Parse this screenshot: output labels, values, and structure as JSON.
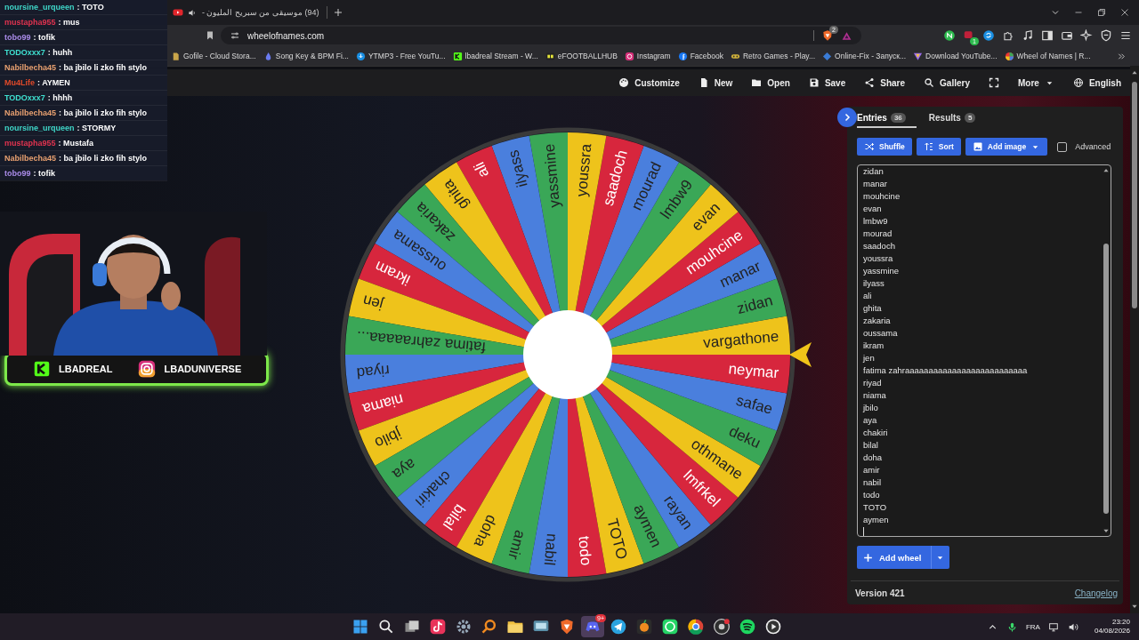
{
  "browser": {
    "tab": {
      "title": "(94) موسيقى من سبريح المليون -"
    },
    "address": "wheelofnames.com",
    "shield_badge": "2",
    "extension_badge": "1",
    "bookmarks": [
      "Gofile - Cloud Stora...",
      "Song Key & BPM Fi...",
      "YTMP3 - Free YouTu...",
      "lbadreal Stream - W...",
      "eFOOTBALLHUB",
      "Instagram",
      "Facebook",
      "Retro Games - Play...",
      "Online-Fix - Запуск...",
      "Download YouTube...",
      "Wheel of Names | R..."
    ]
  },
  "app": {
    "menu": [
      "Customize",
      "New",
      "Open",
      "Save",
      "Share",
      "Gallery",
      "More",
      "English"
    ]
  },
  "wheel": {
    "segments": [
      {
        "label": "vargathone"
      },
      {
        "label": "zidan"
      },
      {
        "label": "manar"
      },
      {
        "label": "mouhcine"
      },
      {
        "label": "evan"
      },
      {
        "label": "lmbw9"
      },
      {
        "label": "mourad"
      },
      {
        "label": "saadoch"
      },
      {
        "label": "youssra"
      },
      {
        "label": "yassmine"
      },
      {
        "label": "ilyass"
      },
      {
        "label": "ali"
      },
      {
        "label": "ghita"
      },
      {
        "label": "zakaria"
      },
      {
        "label": "oussama"
      },
      {
        "label": "ikram"
      },
      {
        "label": "jen"
      },
      {
        "label": "fatima zahraaaaa..."
      },
      {
        "label": "riyad"
      },
      {
        "label": "niama"
      },
      {
        "label": "jbilo"
      },
      {
        "label": "aya"
      },
      {
        "label": "chakiri"
      },
      {
        "label": "bilal"
      },
      {
        "label": "doha"
      },
      {
        "label": "amir"
      },
      {
        "label": "nabil"
      },
      {
        "label": "todo"
      },
      {
        "label": "TOTO"
      },
      {
        "label": "aymen"
      },
      {
        "label": "rayan"
      },
      {
        "label": "lmfrkel"
      },
      {
        "label": "othmane"
      },
      {
        "label": "deku"
      },
      {
        "label": "safae"
      },
      {
        "label": "neymar"
      }
    ]
  },
  "panel": {
    "tabs": [
      {
        "label": "Entries",
        "count": "36",
        "selected": true
      },
      {
        "label": "Results",
        "count": "5",
        "selected": false
      }
    ],
    "actions": [
      "Shuffle",
      "Sort",
      "Add image"
    ],
    "advanced": {
      "label": "Advanced",
      "checked": false
    },
    "entries": [
      "zidan",
      "manar",
      "mouhcine",
      "evan",
      "lmbw9",
      "mourad",
      "saadoch",
      "youssra",
      "yassmine",
      "ilyass",
      "ali",
      "ghita",
      "zakaria",
      "oussama",
      "ikram",
      "jen",
      "fatima zahraaaaaaaaaaaaaaaaaaaaaaaaaa",
      "riyad",
      "niama",
      "jbilo",
      "aya",
      "chakiri",
      "bilal",
      "doha",
      "amir",
      "nabil",
      "todo",
      "TOTO",
      "aymen"
    ],
    "add_wheel": "Add wheel",
    "version": "Version 421",
    "changelog": "Changelog"
  },
  "chat": [
    {
      "user": "noursine_urqueen",
      "color": "#3fd6c8",
      "text": ": TOTO"
    },
    {
      "user": "mustapha955",
      "color": "#e0334f",
      "text": ": mus"
    },
    {
      "user": "tobo99",
      "color": "#a98be8",
      "text": ": tofik"
    },
    {
      "user": "TODOxxx7",
      "color": "#3fe0d0",
      "text": ": huhh"
    },
    {
      "user": "Nabilbecha45",
      "color": "#e8a070",
      "text": ": ba jbilo li zko fih stylo"
    },
    {
      "user": "Mu4Life",
      "color": "#e04a2a",
      "text": ": AYMEN"
    },
    {
      "user": "TODOxxx7",
      "color": "#3fe0d0",
      "text": ": hhhh"
    },
    {
      "user": "Nabilbecha45",
      "color": "#e8a070",
      "text": ": ba jbilo li zko fih stylo"
    },
    {
      "user": "noursine_urqueen",
      "color": "#3fd6c8",
      "text": ": STORMY"
    },
    {
      "user": "mustapha955",
      "color": "#e0334f",
      "text": ": Mustafa"
    },
    {
      "user": "Nabilbecha45",
      "color": "#e8a070",
      "text": ": ba jbilo li zko fih stylo"
    },
    {
      "user": "tobo99",
      "color": "#a98be8",
      "text": ": tofik"
    }
  ],
  "stream": {
    "accounts": [
      "LBADREAL",
      "LBADUNIVERSE"
    ]
  },
  "taskbar": {
    "badge": "9+",
    "language": "FRA",
    "time": "23:20",
    "date": "04/08/2026"
  }
}
